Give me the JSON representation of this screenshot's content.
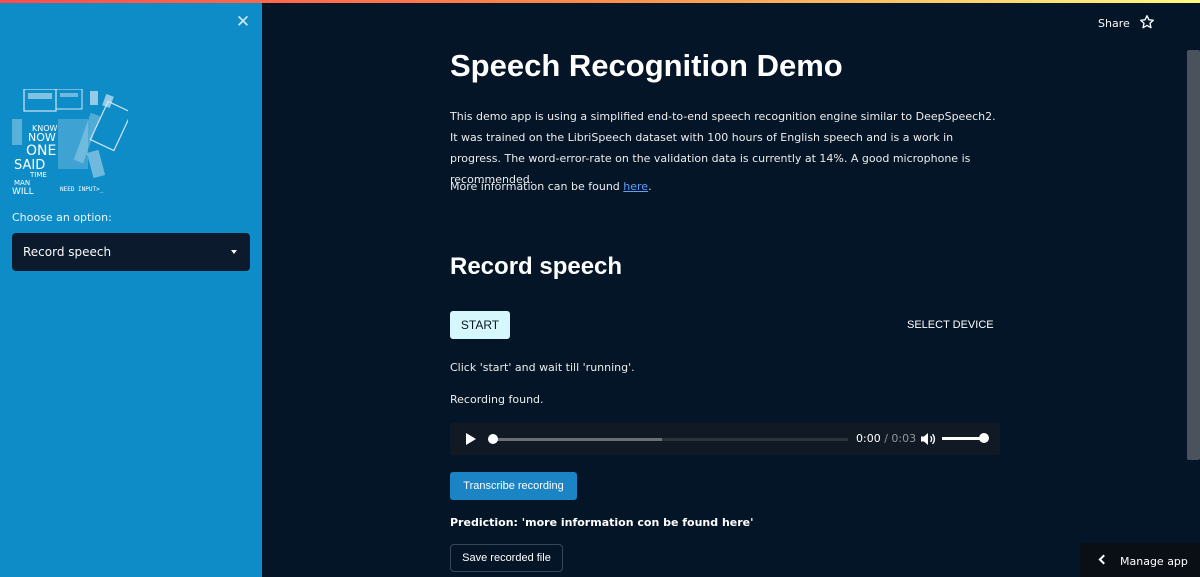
{
  "sidebar": {
    "close_icon": "close-icon",
    "logo_text": [
      "NOW",
      "ONE",
      "SAID",
      "TIME",
      "MAN",
      "WILL",
      "KNOW",
      "NEED INPUT>_"
    ],
    "select_label": "Choose an option:",
    "select_value": "Record speech"
  },
  "header": {
    "share_label": "Share",
    "star_icon": "star-icon"
  },
  "main": {
    "title": "Speech Recognition Demo",
    "description": "This demo app is using a simplified end-to-end speech recognition engine similar to DeepSpeech2. It was trained on the LibriSpeech dataset with 100 hours of English speech and is a work in progress. The word-error-rate on the validation data is currently at 14%. A good microphone is recommended.",
    "more_prefix": "More information can be found ",
    "more_link": "here",
    "more_suffix": ".",
    "section_title": "Record speech",
    "start_label": "START",
    "select_device_label": "SELECT DEVICE",
    "instruction": "Click 'start' and wait till 'running'.",
    "status": "Recording found.",
    "audio": {
      "current_time": "0:00",
      "separator": " / ",
      "duration": "0:03",
      "buffered_fraction": 0.48,
      "volume": 0.9
    },
    "transcribe_label": "Transcribe recording",
    "prediction": "Prediction: 'more information con be found here'",
    "save_label": "Save recorded file"
  },
  "footer": {
    "manage_label": "Manage app"
  },
  "colors": {
    "sidebar_bg": "#0e8cc8",
    "main_bg": "#051528",
    "link": "#5b9fff",
    "start_bg": "#d6f8fd",
    "transcribe_bg": "#1a84c4"
  }
}
